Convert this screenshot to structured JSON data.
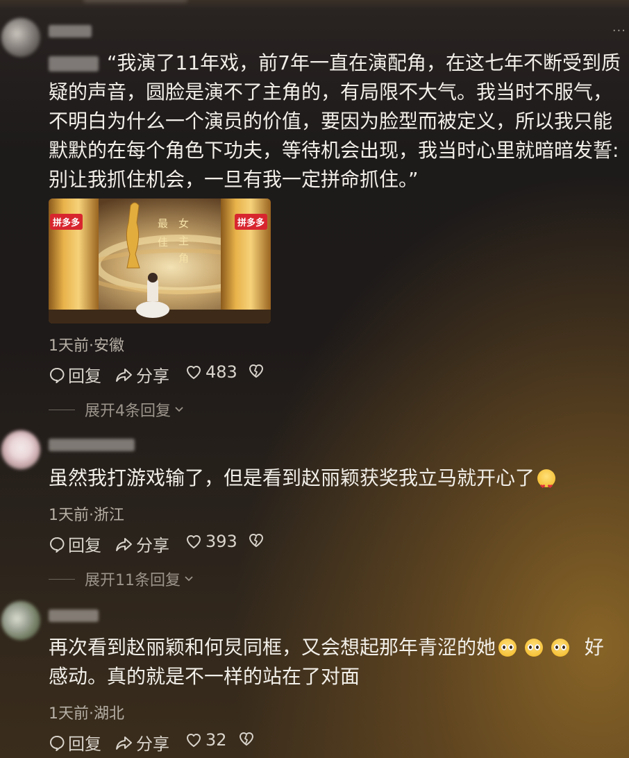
{
  "comments": [
    {
      "text": "“我演了11年戏，前7年一直在演配角，在这七年不断受到质疑的声音，圆脸是演不了主角的，有局限不大气。我当时不服气，不明白为什么一个演员的价值，要因为脸型而被定义，所以我只能默默的在每个角色下功夫，等待机会出现，我当时心里就暗暗发誓:别让我抓住机会，一旦有我一定拼命抓住。”",
      "image": {
        "sponsor_left": "拼多多",
        "sponsor_right": "拼多多",
        "award_line1": "最佳",
        "award_line2": "女主角"
      },
      "meta": "1天前·安徽",
      "reply_label": "回复",
      "share_label": "分享",
      "likes": "483",
      "expand_label": "展开4条回复"
    },
    {
      "text": "虽然我打游戏输了，但是看到赵丽颖获奖我立马就开心了",
      "meta": "1天前·浙江",
      "reply_label": "回复",
      "share_label": "分享",
      "likes": "393",
      "expand_label": "展开11条回复"
    },
    {
      "text_part1": "再次看到赵丽颖和何炅同框，又会想起那年青涩的她",
      "text_part2": "好",
      "text_line2": "感动。真的就是不一样的站在了对面",
      "meta": "1天前·湖北",
      "reply_label": "回复",
      "share_label": "分享",
      "likes": "32"
    }
  ],
  "colors": {
    "text": "#f2efe9",
    "meta": "#b7b0a6",
    "sponsor_red": "#d8262f",
    "gold": "#d6a94a"
  }
}
